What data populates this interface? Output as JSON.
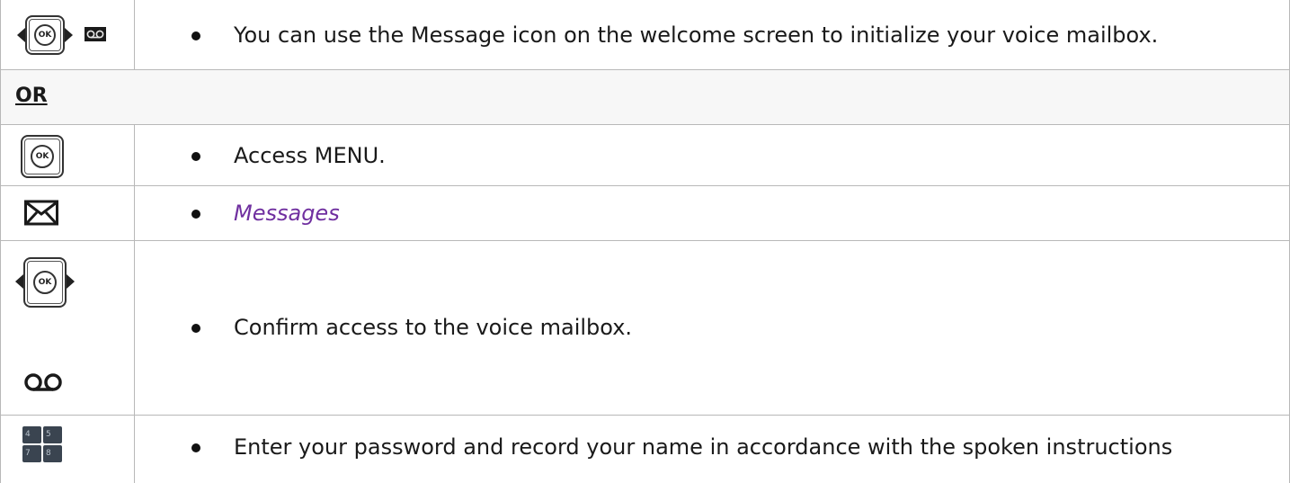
{
  "rows": [
    {
      "icons": [
        "ok-navigation-key-icon",
        "voicemail-badge-icon"
      ],
      "text": "You can use the Message icon on the welcome screen to initialize your voice mailbox."
    },
    {
      "label": "OR"
    },
    {
      "icons": [
        "ok-key-icon"
      ],
      "text": "Access MENU."
    },
    {
      "icons": [
        "envelope-icon"
      ],
      "text": "Messages",
      "text_color": "#7030a0"
    },
    {
      "icons": [
        "ok-navigation-key-icon",
        "voicemail-icon"
      ],
      "text": "Confirm access to the voice mailbox."
    },
    {
      "icons": [
        "keypad-icon"
      ],
      "text": "Enter your password and record your name in accordance with the spoken instructions"
    }
  ],
  "icon_labels": {
    "ok": "OK",
    "keys": [
      "4",
      "5",
      "7",
      "8"
    ]
  }
}
